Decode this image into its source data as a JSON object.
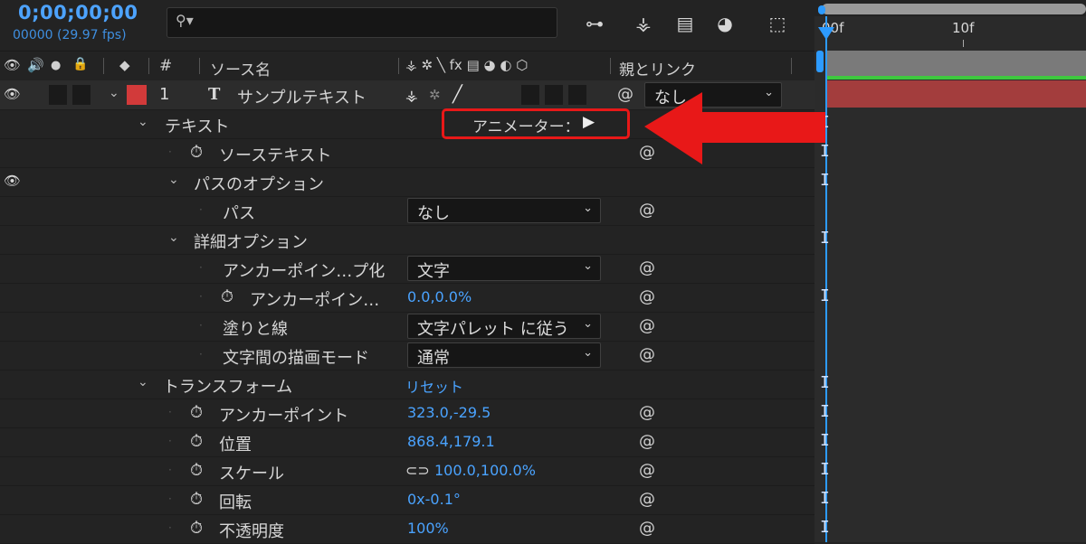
{
  "header": {
    "timecode": "0;00;00;00",
    "frame_info": "00000 (29.97 fps)",
    "search_placeholder": ""
  },
  "columns": {
    "num": "#",
    "source_name": "ソース名",
    "parent_link": "親とリンク"
  },
  "layer": {
    "number": "1",
    "type_glyph": "T",
    "name": "サンプルテキスト",
    "parent_value": "なし",
    "label_color": "#d23a3a"
  },
  "rows": {
    "text_group": "テキスト",
    "animator": "アニメーター：",
    "source_text": "ソーステキスト",
    "path_options": "パスのオプション",
    "path": "パス",
    "path_value": "なし",
    "more_options": "詳細オプション",
    "anchor_grouping": "アンカーポイン…プ化",
    "anchor_grouping_value": "文字",
    "grouping_alignment": "アンカーポイン…",
    "grouping_alignment_value": "0.0,0.0%",
    "fill_stroke": "塗りと線",
    "fill_stroke_value": "文字パレット に従う",
    "blend_mode": "文字間の描画モード",
    "blend_mode_value": "通常",
    "transform": "トランスフォーム",
    "reset": "リセット",
    "anchor_point": "アンカーポイント",
    "anchor_point_value": "323.0,-29.5",
    "position": "位置",
    "position_value": "868.4,179.1",
    "scale": "スケール",
    "scale_value": "100.0,100.0%",
    "rotation": "回転",
    "rotation_value": "0x-0.1°",
    "opacity": "不透明度",
    "opacity_value": "100%"
  },
  "timeline": {
    "start_label": "00f",
    "mark_10": "10f"
  },
  "colors": {
    "accent_blue": "#2d9bff",
    "highlight_red": "#e81818",
    "layer_bar": "#a33d3d",
    "work_area_green": "#3ec83e"
  }
}
